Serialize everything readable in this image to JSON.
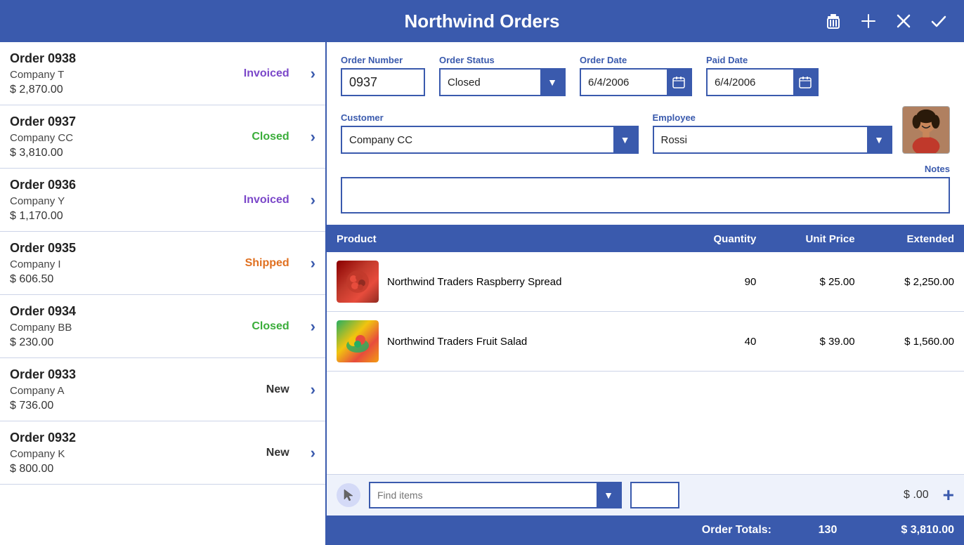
{
  "header": {
    "title": "Northwind Orders",
    "delete_label": "🗑",
    "add_label": "+",
    "cancel_label": "✕",
    "confirm_label": "✓"
  },
  "orders": [
    {
      "id": "0938",
      "title": "Order 0938",
      "company": "Company T",
      "amount": "$ 2,870.00",
      "status": "Invoiced",
      "status_class": "status-invoiced"
    },
    {
      "id": "0937",
      "title": "Order 0937",
      "company": "Company CC",
      "amount": "$ 3,810.00",
      "status": "Closed",
      "status_class": "status-closed"
    },
    {
      "id": "0936",
      "title": "Order 0936",
      "company": "Company Y",
      "amount": "$ 1,170.00",
      "status": "Invoiced",
      "status_class": "status-invoiced"
    },
    {
      "id": "0935",
      "title": "Order 0935",
      "company": "Company I",
      "amount": "$ 606.50",
      "status": "Shipped",
      "status_class": "status-shipped"
    },
    {
      "id": "0934",
      "title": "Order 0934",
      "company": "Company BB",
      "amount": "$ 230.00",
      "status": "Closed",
      "status_class": "status-closed"
    },
    {
      "id": "0933",
      "title": "Order 0933",
      "company": "Company A",
      "amount": "$ 736.00",
      "status": "New",
      "status_class": "status-new"
    },
    {
      "id": "0932",
      "title": "Order 0932",
      "company": "Company K",
      "amount": "$ 800.00",
      "status": "New",
      "status_class": "status-new"
    }
  ],
  "form": {
    "order_number_label": "Order Number",
    "order_number_value": "0937",
    "order_status_label": "Order Status",
    "order_status_value": "Closed",
    "order_date_label": "Order Date",
    "order_date_value": "6/4/2006",
    "paid_date_label": "Paid Date",
    "paid_date_value": "6/4/2006",
    "customer_label": "Customer",
    "customer_value": "Company CC",
    "employee_label": "Employee",
    "employee_value": "Rossi",
    "notes_label": "Notes",
    "notes_value": ""
  },
  "table": {
    "col_product": "Product",
    "col_quantity": "Quantity",
    "col_unit_price": "Unit Price",
    "col_extended": "Extended",
    "rows": [
      {
        "name": "Northwind Traders Raspberry Spread",
        "quantity": "90",
        "unit_price": "$ 25.00",
        "extended": "$ 2,250.00",
        "image_type": "raspberry"
      },
      {
        "name": "Northwind Traders Fruit Salad",
        "quantity": "40",
        "unit_price": "$ 39.00",
        "extended": "$ 1,560.00",
        "image_type": "fruit-salad"
      }
    ]
  },
  "add_item": {
    "find_items_placeholder": "Find items",
    "price_display": "$ .00",
    "add_button_label": "+"
  },
  "totals": {
    "label": "Order Totals:",
    "quantity": "130",
    "amount": "$ 3,810.00"
  }
}
